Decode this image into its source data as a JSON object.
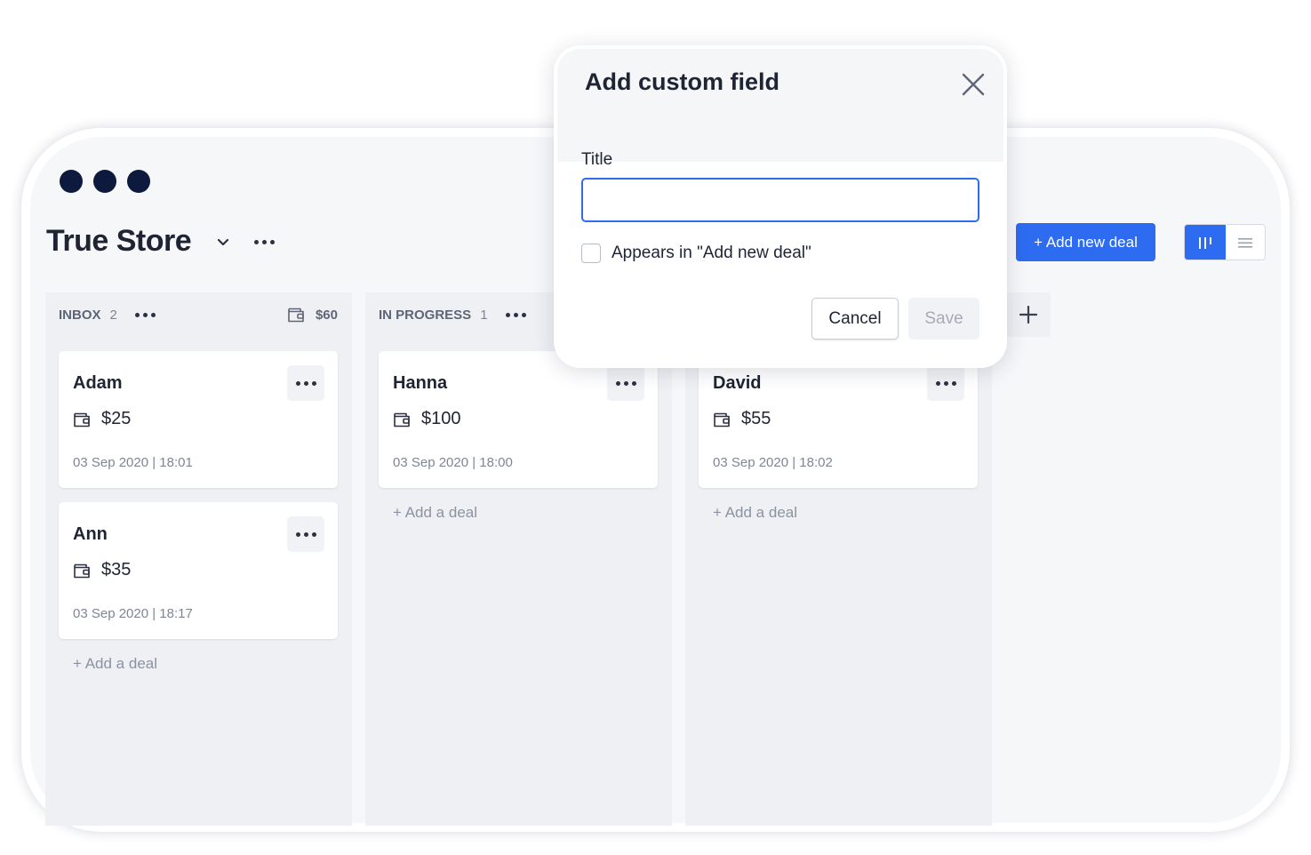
{
  "header": {
    "store_name": "True Store",
    "add_new_deal_label": "+ Add new deal"
  },
  "columns": [
    {
      "title": "INBOX",
      "count": "2",
      "total": "$60",
      "cards": [
        {
          "name": "Adam",
          "amount": "$25",
          "date": "03 Sep 2020 | 18:01"
        },
        {
          "name": "Ann",
          "amount": "$35",
          "date": "03 Sep 2020 | 18:17"
        }
      ],
      "add_label": "+ Add a deal"
    },
    {
      "title": "IN PROGRESS",
      "count": "1",
      "cards": [
        {
          "name": "Hanna",
          "amount": "$100",
          "date": "03 Sep 2020 | 18:00"
        }
      ],
      "add_label": "+ Add a deal"
    },
    {
      "cards": [
        {
          "name": "David",
          "amount": "$55",
          "date": "03 Sep 2020 | 18:02"
        }
      ],
      "add_label": "+ Add a deal"
    }
  ],
  "modal": {
    "title": "Add custom field",
    "field_label": "Title",
    "field_value": "",
    "checkbox_label": "Appears in \"Add new deal\"",
    "checkbox_checked": false,
    "cancel_label": "Cancel",
    "save_label": "Save"
  },
  "icons": {
    "window_dots": "window-control-dots",
    "wallet": "wallet-icon",
    "more": "more-horizontal-icon",
    "close": "close-icon",
    "add_column": "plus-icon",
    "view_board": "board-view-icon",
    "view_list": "list-view-icon",
    "store_menu": "chevron-down-icon"
  },
  "colors": {
    "accent": "#2d6bf0",
    "window_dots": "#0e1a3d",
    "text": "#1e2433",
    "muted": "#7e8596",
    "column_bg": "#eef0f4"
  }
}
